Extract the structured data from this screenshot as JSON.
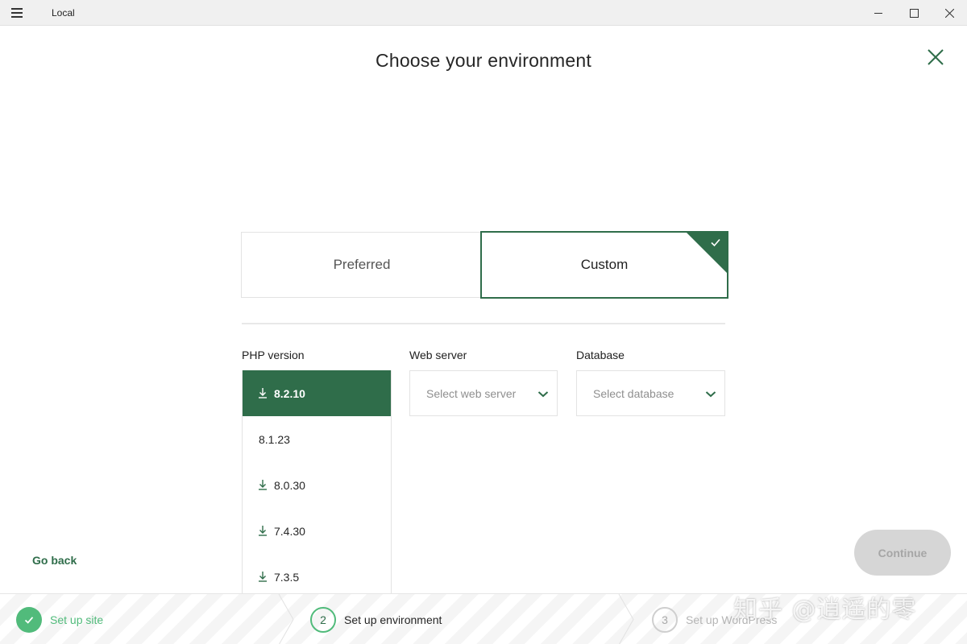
{
  "window": {
    "title": "Local",
    "menu_icon": "hamburger-icon",
    "controls": [
      "minimize-icon",
      "maximize-icon",
      "close-icon"
    ]
  },
  "header": {
    "title": "Choose your environment",
    "close_icon": "close-icon"
  },
  "environment": {
    "options": [
      {
        "label": "Preferred",
        "selected": false
      },
      {
        "label": "Custom",
        "selected": true
      }
    ],
    "selected_icon": "checkmark-icon"
  },
  "php": {
    "label": "PHP version",
    "versions": [
      {
        "label": "8.2.10",
        "selected": true,
        "download_icon": true
      },
      {
        "label": "8.1.23",
        "selected": false,
        "download_icon": false
      },
      {
        "label": "8.0.30",
        "selected": false,
        "download_icon": true
      },
      {
        "label": "7.4.30",
        "selected": false,
        "download_icon": true
      },
      {
        "label": "7.3.5",
        "selected": false,
        "download_icon": true
      }
    ]
  },
  "web_server": {
    "label": "Web server",
    "placeholder": "Select web server"
  },
  "database": {
    "label": "Database",
    "placeholder": "Select database"
  },
  "actions": {
    "go_back": "Go back",
    "continue": "Continue"
  },
  "steps": [
    {
      "number": "",
      "label": "Set up site",
      "state": "completed"
    },
    {
      "number": "2",
      "label": "Set up environment",
      "state": "active"
    },
    {
      "number": "3",
      "label": "Set up WordPress",
      "state": "pending"
    }
  ],
  "watermark": "知乎 @逍遥的零",
  "colors": {
    "accent": "#2f6d4a",
    "completed": "#51bb7b",
    "disabled_bg": "#d6d6d6",
    "disabled_text": "#a6a6a6"
  }
}
